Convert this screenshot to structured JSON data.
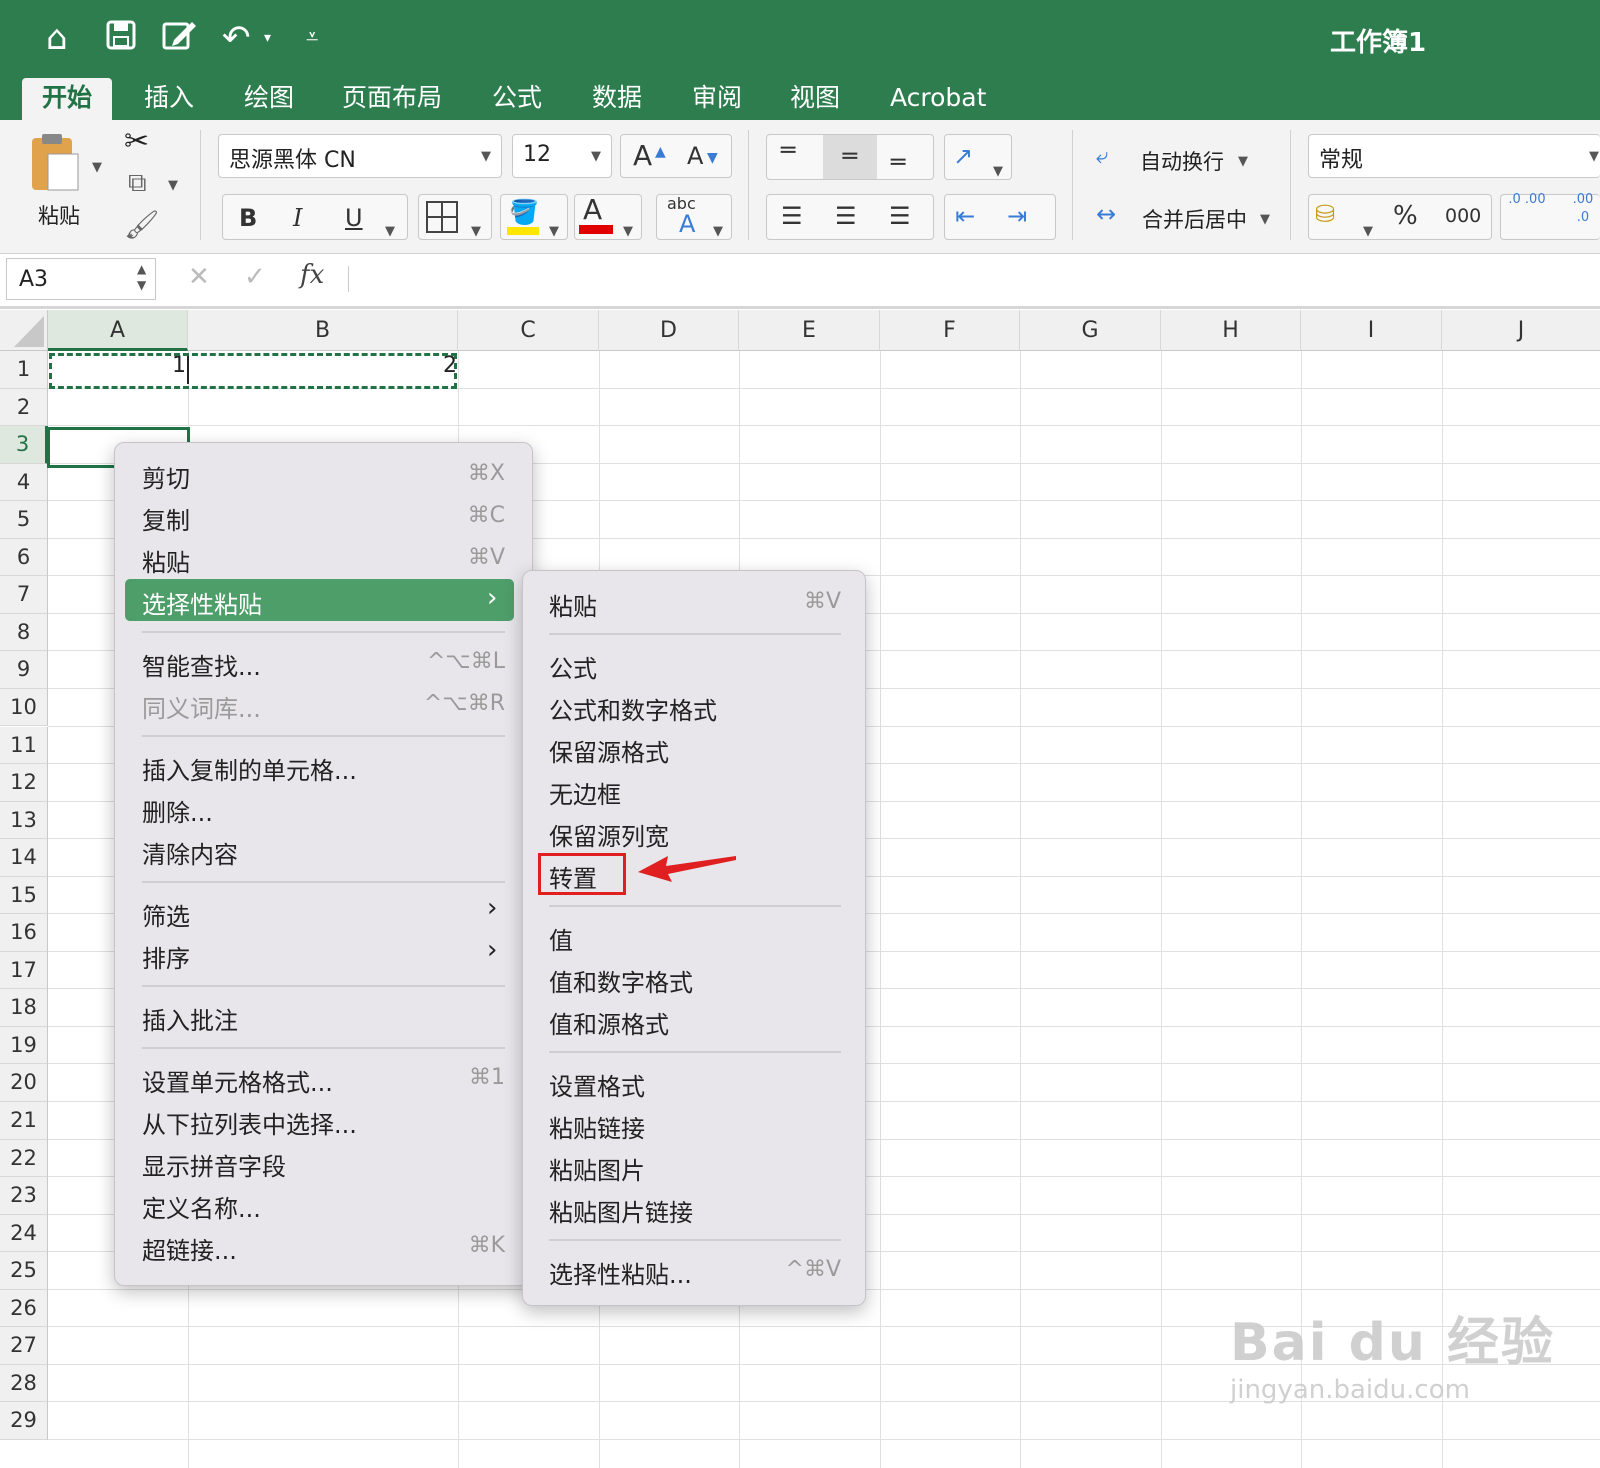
{
  "title_bar": {
    "workbook_title": "工作簿1",
    "icons": [
      "home-icon",
      "save-icon",
      "edit-icon",
      "undo-icon",
      "customize-icon"
    ]
  },
  "tabs": [
    {
      "label": "开始",
      "active": true
    },
    {
      "label": "插入"
    },
    {
      "label": "绘图"
    },
    {
      "label": "页面布局"
    },
    {
      "label": "公式"
    },
    {
      "label": "数据"
    },
    {
      "label": "审阅"
    },
    {
      "label": "视图"
    },
    {
      "label": "Acrobat"
    }
  ],
  "ribbon": {
    "paste_label": "粘贴",
    "font_name": "思源黑体 CN",
    "font_size": "12",
    "bold": "B",
    "italic": "I",
    "underline": "U",
    "grow_font": "A",
    "shrink_font": "A",
    "font_color_letter": "A",
    "phonetic_top": "abc",
    "phonetic_bottom": "A",
    "wrap_text": "自动换行",
    "merge_center": "合并后居中",
    "number_format": "常规",
    "percent": "%",
    "thousands": "000",
    "inc_decimal": ".0 .00",
    "dec_decimal": ".00 .0",
    "colors": {
      "highlight": "#ffe600",
      "font_color": "#e00000",
      "accent": "#2e7d4f"
    }
  },
  "formula_bar": {
    "name_box": "A3",
    "cancel": "✕",
    "enter": "✓",
    "fx": "fx",
    "formula": ""
  },
  "grid": {
    "columns": [
      "A",
      "B",
      "C",
      "D",
      "E",
      "F",
      "G",
      "H",
      "I",
      "J"
    ],
    "rows": [
      "1",
      "2",
      "3",
      "4",
      "5",
      "6",
      "7",
      "8",
      "9",
      "10",
      "11",
      "12",
      "13",
      "14",
      "15",
      "16",
      "17",
      "18",
      "19",
      "20",
      "21",
      "22",
      "23",
      "24",
      "25",
      "26",
      "27",
      "28",
      "29"
    ],
    "cells": {
      "A1": "1",
      "B1": "2"
    },
    "active_cell": "A3",
    "copy_range": "A1:B1"
  },
  "context_menu": {
    "items": [
      {
        "label": "剪切",
        "shortcut": "⌘X"
      },
      {
        "label": "复制",
        "shortcut": "⌘C"
      },
      {
        "label": "粘贴",
        "shortcut": "⌘V"
      },
      {
        "label": "选择性粘贴",
        "submenu": true,
        "highlighted": true
      },
      {
        "label": "智能查找...",
        "shortcut": "^⌥⌘L"
      },
      {
        "label": "同义词库...",
        "shortcut": "^⌥⌘R",
        "disabled": true
      },
      {
        "label": "插入复制的单元格..."
      },
      {
        "label": "删除..."
      },
      {
        "label": "清除内容"
      },
      {
        "label": "筛选",
        "submenu": true
      },
      {
        "label": "排序",
        "submenu": true
      },
      {
        "label": "插入批注"
      },
      {
        "label": "设置单元格格式...",
        "shortcut": "⌘1"
      },
      {
        "label": "从下拉列表中选择..."
      },
      {
        "label": "显示拼音字段"
      },
      {
        "label": "定义名称..."
      },
      {
        "label": "超链接...",
        "shortcut": "⌘K"
      }
    ]
  },
  "submenu": {
    "items": [
      {
        "label": "粘贴",
        "shortcut": "⌘V"
      },
      {
        "label": "公式"
      },
      {
        "label": "公式和数字格式"
      },
      {
        "label": "保留源格式"
      },
      {
        "label": "无边框"
      },
      {
        "label": "保留源列宽"
      },
      {
        "label": "转置",
        "annotated": true
      },
      {
        "label": "值"
      },
      {
        "label": "值和数字格式"
      },
      {
        "label": "值和源格式"
      },
      {
        "label": "设置格式"
      },
      {
        "label": "粘贴链接"
      },
      {
        "label": "粘贴图片"
      },
      {
        "label": "粘贴图片链接"
      },
      {
        "label": "选择性粘贴...",
        "shortcut": "^⌘V"
      }
    ],
    "annotation_color": "#e02020"
  },
  "watermark": {
    "line1": "Bai du 经验",
    "line2": "jingyan.baidu.com"
  }
}
